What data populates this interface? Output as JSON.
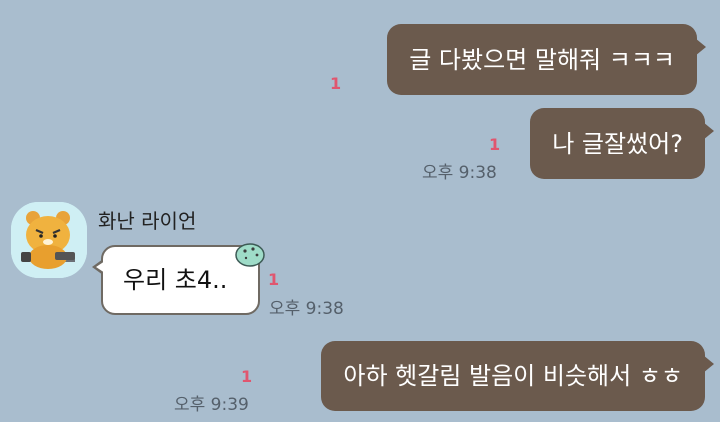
{
  "colors": {
    "background": "#a9bdce",
    "my_bubble": "#6b5a4d",
    "their_bubble": "#ffffff",
    "unread": "#e0566f"
  },
  "messages": [
    {
      "sender": "me",
      "text": "글 다봤으면 말해줘 ㅋㅋㅋ",
      "unread": "1",
      "time": ""
    },
    {
      "sender": "me",
      "text": "나 글잘썼어?",
      "unread": "1",
      "time": "오후 9:38"
    },
    {
      "sender": "them",
      "name": "화난 라이언",
      "avatar_icon": "angry-ryan-avatar-icon",
      "sticker_icon": "mint-icecream-icon",
      "text": "우리 초4..",
      "unread": "1",
      "time": "오후 9:38"
    },
    {
      "sender": "me",
      "text": "아하 헷갈림 발음이 비슷해서 ㅎㅎ",
      "unread": "1",
      "time": "오후 9:39"
    }
  ]
}
